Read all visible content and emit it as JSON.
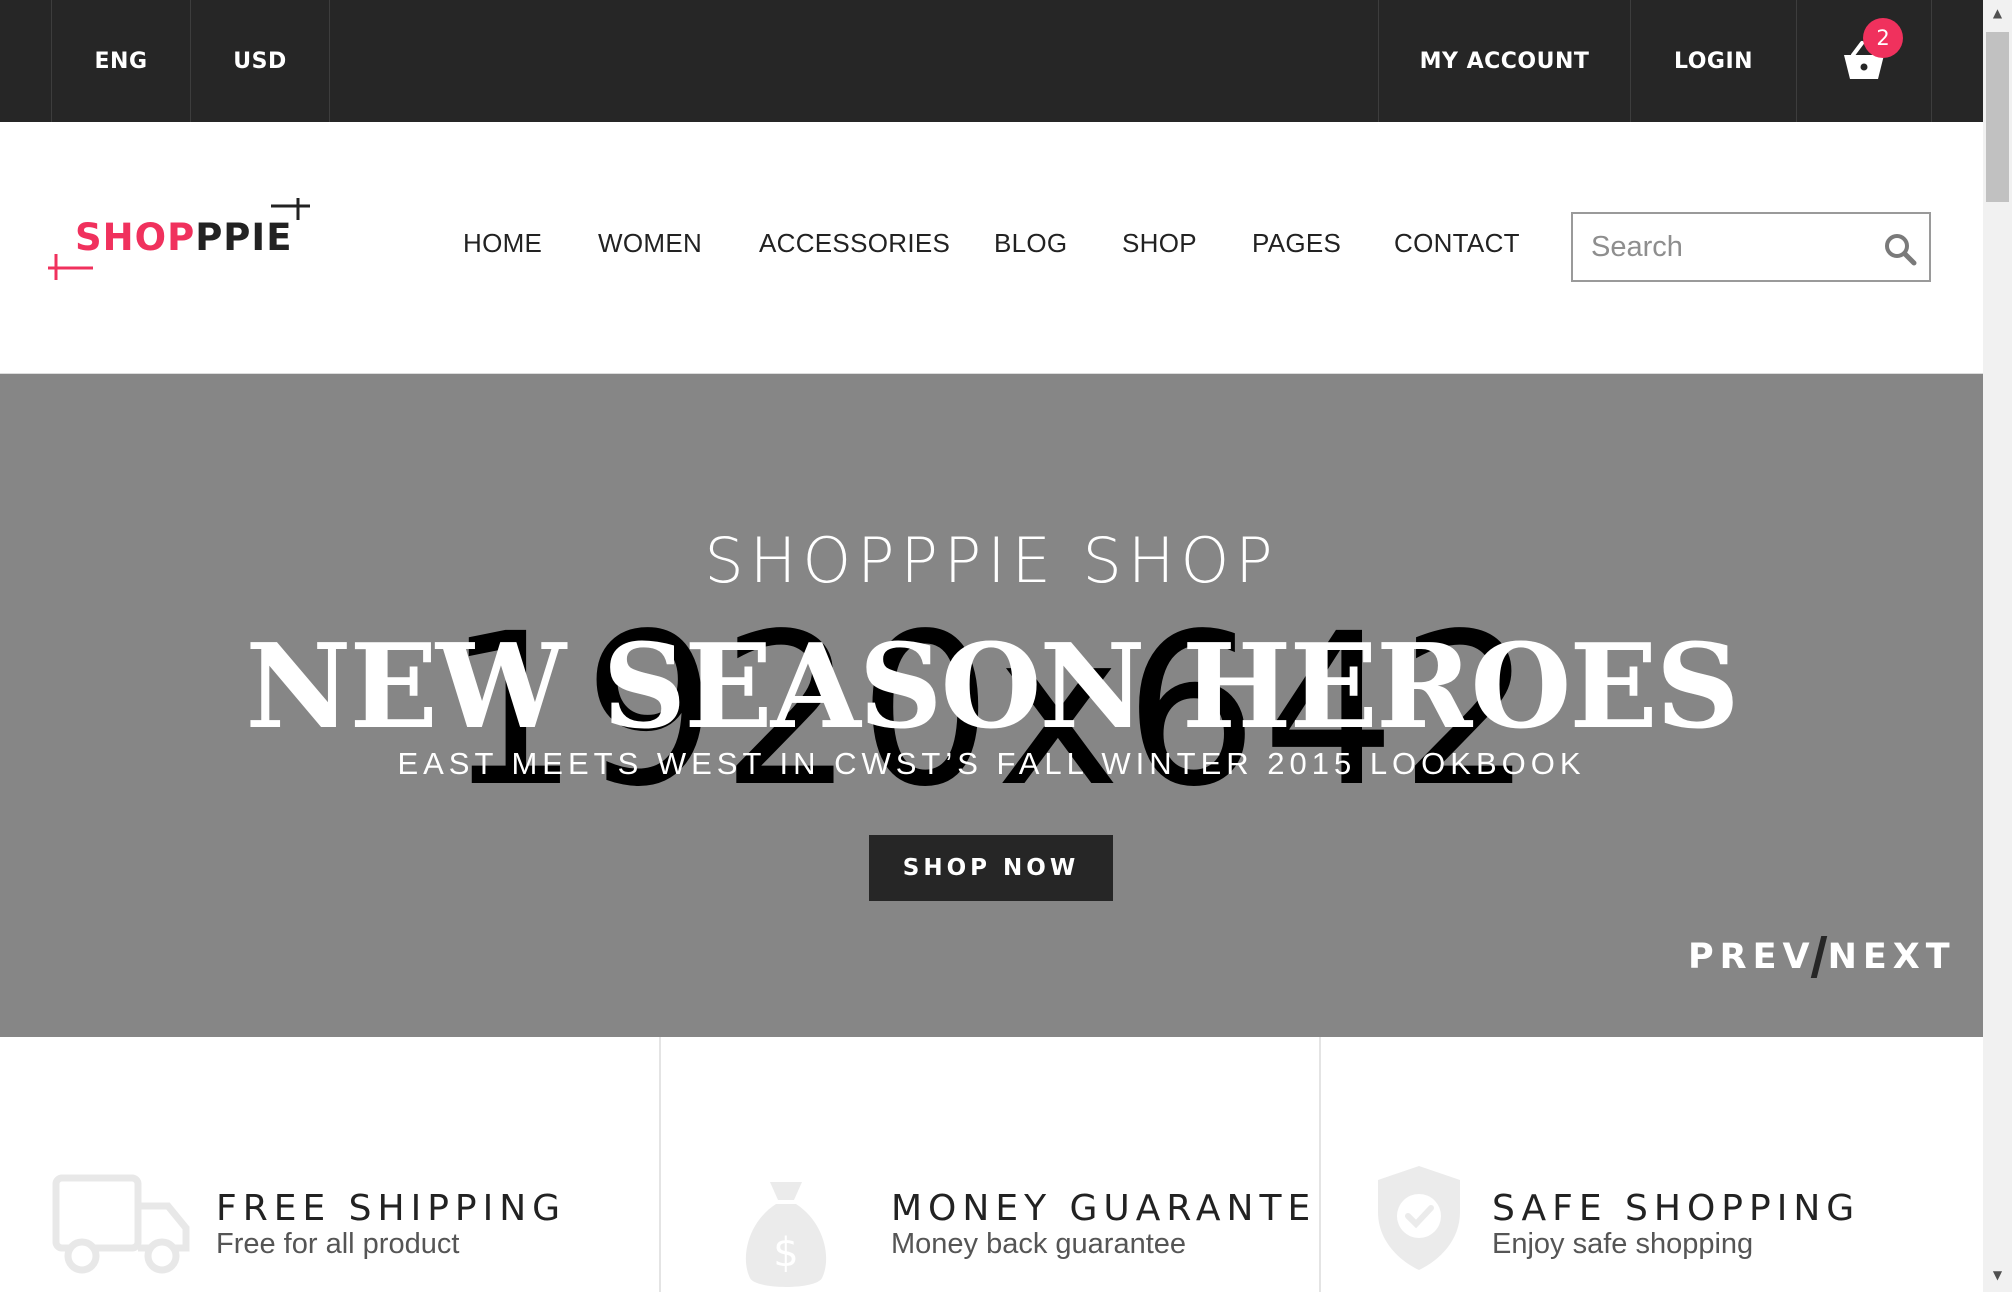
{
  "topbar": {
    "language": "ENG",
    "currency": "USD",
    "my_account": "MY ACCOUNT",
    "login": "LOGIN",
    "cart_count": "2"
  },
  "header": {
    "logo_part1": "SHOP",
    "logo_part2": "PPIE",
    "nav": [
      "HOME",
      "WOMEN",
      "ACCESSORIES",
      "BLOG",
      "SHOP",
      "PAGES",
      "CONTACT"
    ],
    "search_placeholder": "Search"
  },
  "hero": {
    "placeholder_size": "1920x642",
    "subtitle": "SHOPPPIE SHOP",
    "title": "NEW SEASON HEROES",
    "tagline": "EAST MEETS WEST IN CWST’S FALL WINTER 2015 LOOKBOOK",
    "button": "SHOP NOW",
    "prev": "PREV",
    "next": "NEXT"
  },
  "features": [
    {
      "icon": "truck-icon",
      "title": "FREE SHIPPING",
      "subtitle": "Free for all product"
    },
    {
      "icon": "money-bag-icon",
      "title": "MONEY GUARANTE",
      "subtitle": "Money back guarantee"
    },
    {
      "icon": "shield-check-icon",
      "title": "SAFE SHOPPING",
      "subtitle": "Enjoy safe shopping"
    }
  ],
  "colors": {
    "topbar_bg": "#262626",
    "accent": "#f0315d",
    "hero_bg": "#868686"
  }
}
